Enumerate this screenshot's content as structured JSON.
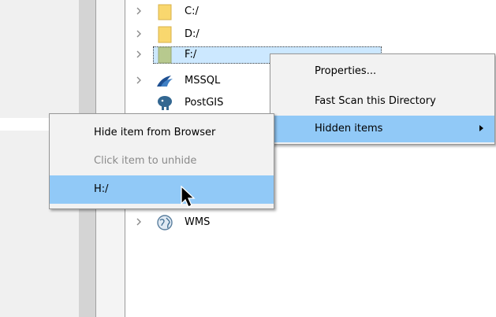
{
  "tree": {
    "items": [
      {
        "label": "C:/",
        "icon": "folder-icon"
      },
      {
        "label": "D:/",
        "icon": "folder-icon"
      },
      {
        "label": "F:/",
        "icon": "drive-icon"
      },
      {
        "label": "MSSQL",
        "icon": "mssql-icon"
      },
      {
        "label": "PostGIS",
        "icon": "postgis-elephant-icon"
      },
      {
        "label": "WMS",
        "icon": "globe-icon"
      }
    ]
  },
  "context_menu": {
    "items": [
      {
        "label": "Properties..."
      },
      {
        "label": "Fast Scan this Directory"
      },
      {
        "label": "Hidden items",
        "has_submenu": true
      }
    ]
  },
  "submenu": {
    "items": [
      {
        "label": "Hide item from Browser"
      },
      {
        "label": "Click item to unhide",
        "disabled": true
      },
      {
        "label": "H:/"
      }
    ]
  },
  "colors": {
    "menu_highlight": "#91c9f7",
    "selection_bg": "#cce8ff",
    "folder": "#f9d76e"
  }
}
